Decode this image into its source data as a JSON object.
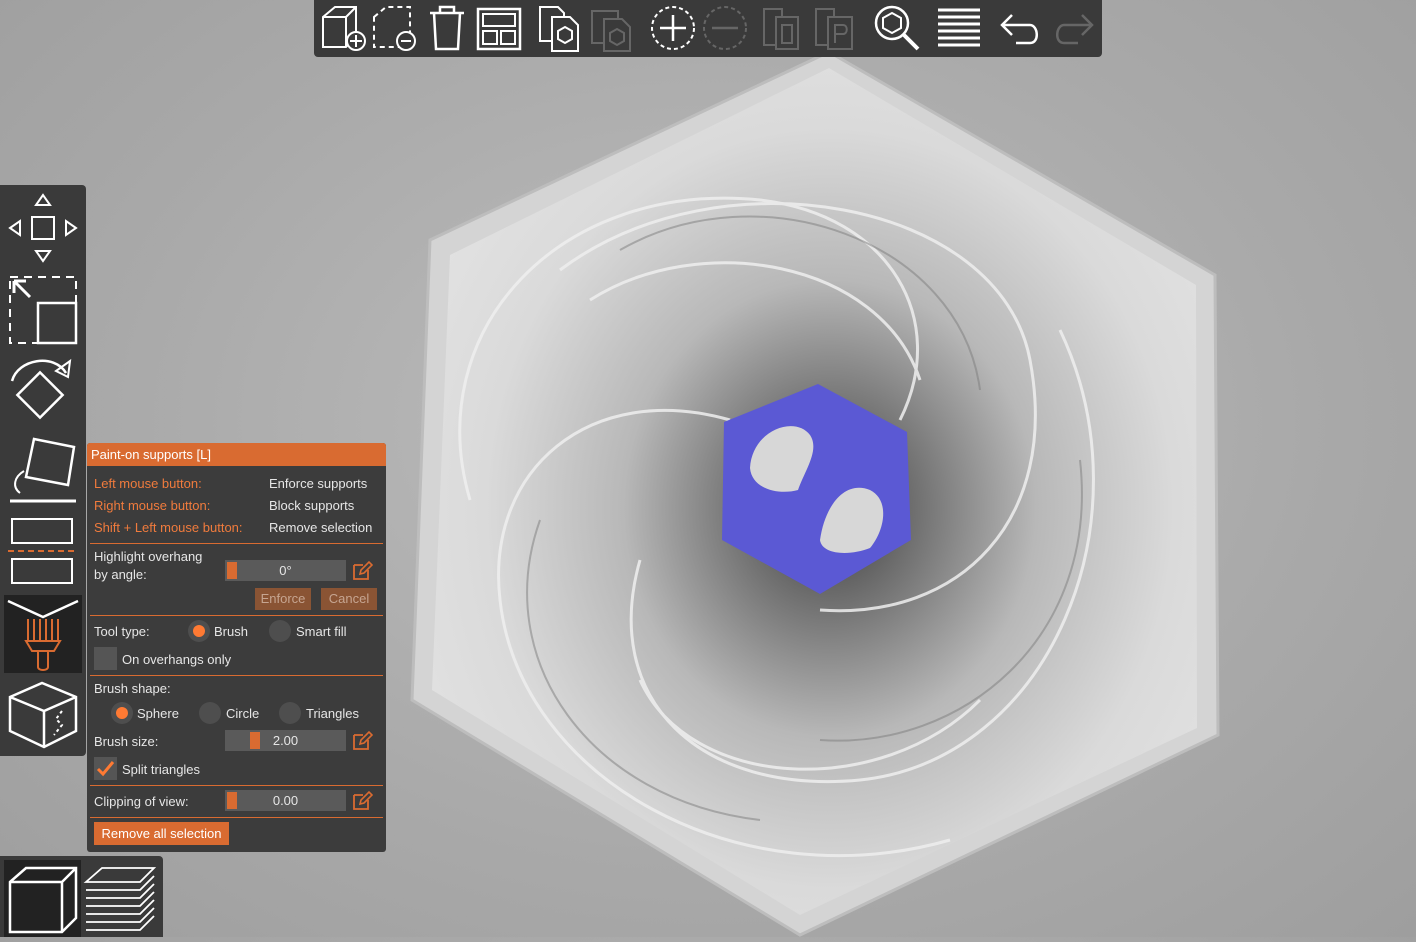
{
  "panel": {
    "title": "Paint-on supports [L]",
    "hints": [
      {
        "key": "Left mouse button:",
        "action": "Enforce supports"
      },
      {
        "key": "Right mouse button:",
        "action": "Block supports"
      },
      {
        "key": "Shift + Left mouse button:",
        "action": "Remove selection"
      }
    ],
    "overhang_label_1": "Highlight overhang",
    "overhang_label_2": "by angle:",
    "overhang_value": "0°",
    "enforce_label": "Enforce",
    "cancel_label": "Cancel",
    "tool_type_label": "Tool type:",
    "tool_brush": "Brush",
    "tool_smart_fill": "Smart fill",
    "tool_selected": "Brush",
    "on_overhangs_only": "On overhangs only",
    "on_overhangs_checked": false,
    "brush_shape_label": "Brush shape:",
    "shape_sphere": "Sphere",
    "shape_circle": "Circle",
    "shape_triangles": "Triangles",
    "shape_selected": "Sphere",
    "brush_size_label": "Brush size:",
    "brush_size_value": "2.00",
    "split_triangles": "Split triangles",
    "split_triangles_checked": true,
    "clipping_label": "Clipping of view:",
    "clipping_value": "0.00",
    "remove_all_label": "Remove all selection"
  },
  "top_toolbar": [
    "add-icon",
    "delete-icon",
    "delete-all-icon",
    "arrange-icon",
    "copy-icon",
    "paste-icon",
    "add-instance-icon",
    "remove-instance-icon",
    "split-objects-icon",
    "split-parts-icon",
    "search-icon",
    "layers-editor-icon",
    "undo-icon",
    "redo-icon"
  ],
  "left_toolbar": [
    "move-icon",
    "scale-icon",
    "rotate-icon",
    "place-on-face-icon",
    "cut-icon",
    "paint-supports-icon",
    "seam-painting-icon"
  ],
  "view_toggle": [
    "3d-view-icon",
    "preview-icon"
  ],
  "colors": {
    "accent": "#d96b31",
    "panel": "#3c3c3c",
    "model_gray": "#cfcfcf",
    "painted": "#5c5ad1"
  }
}
